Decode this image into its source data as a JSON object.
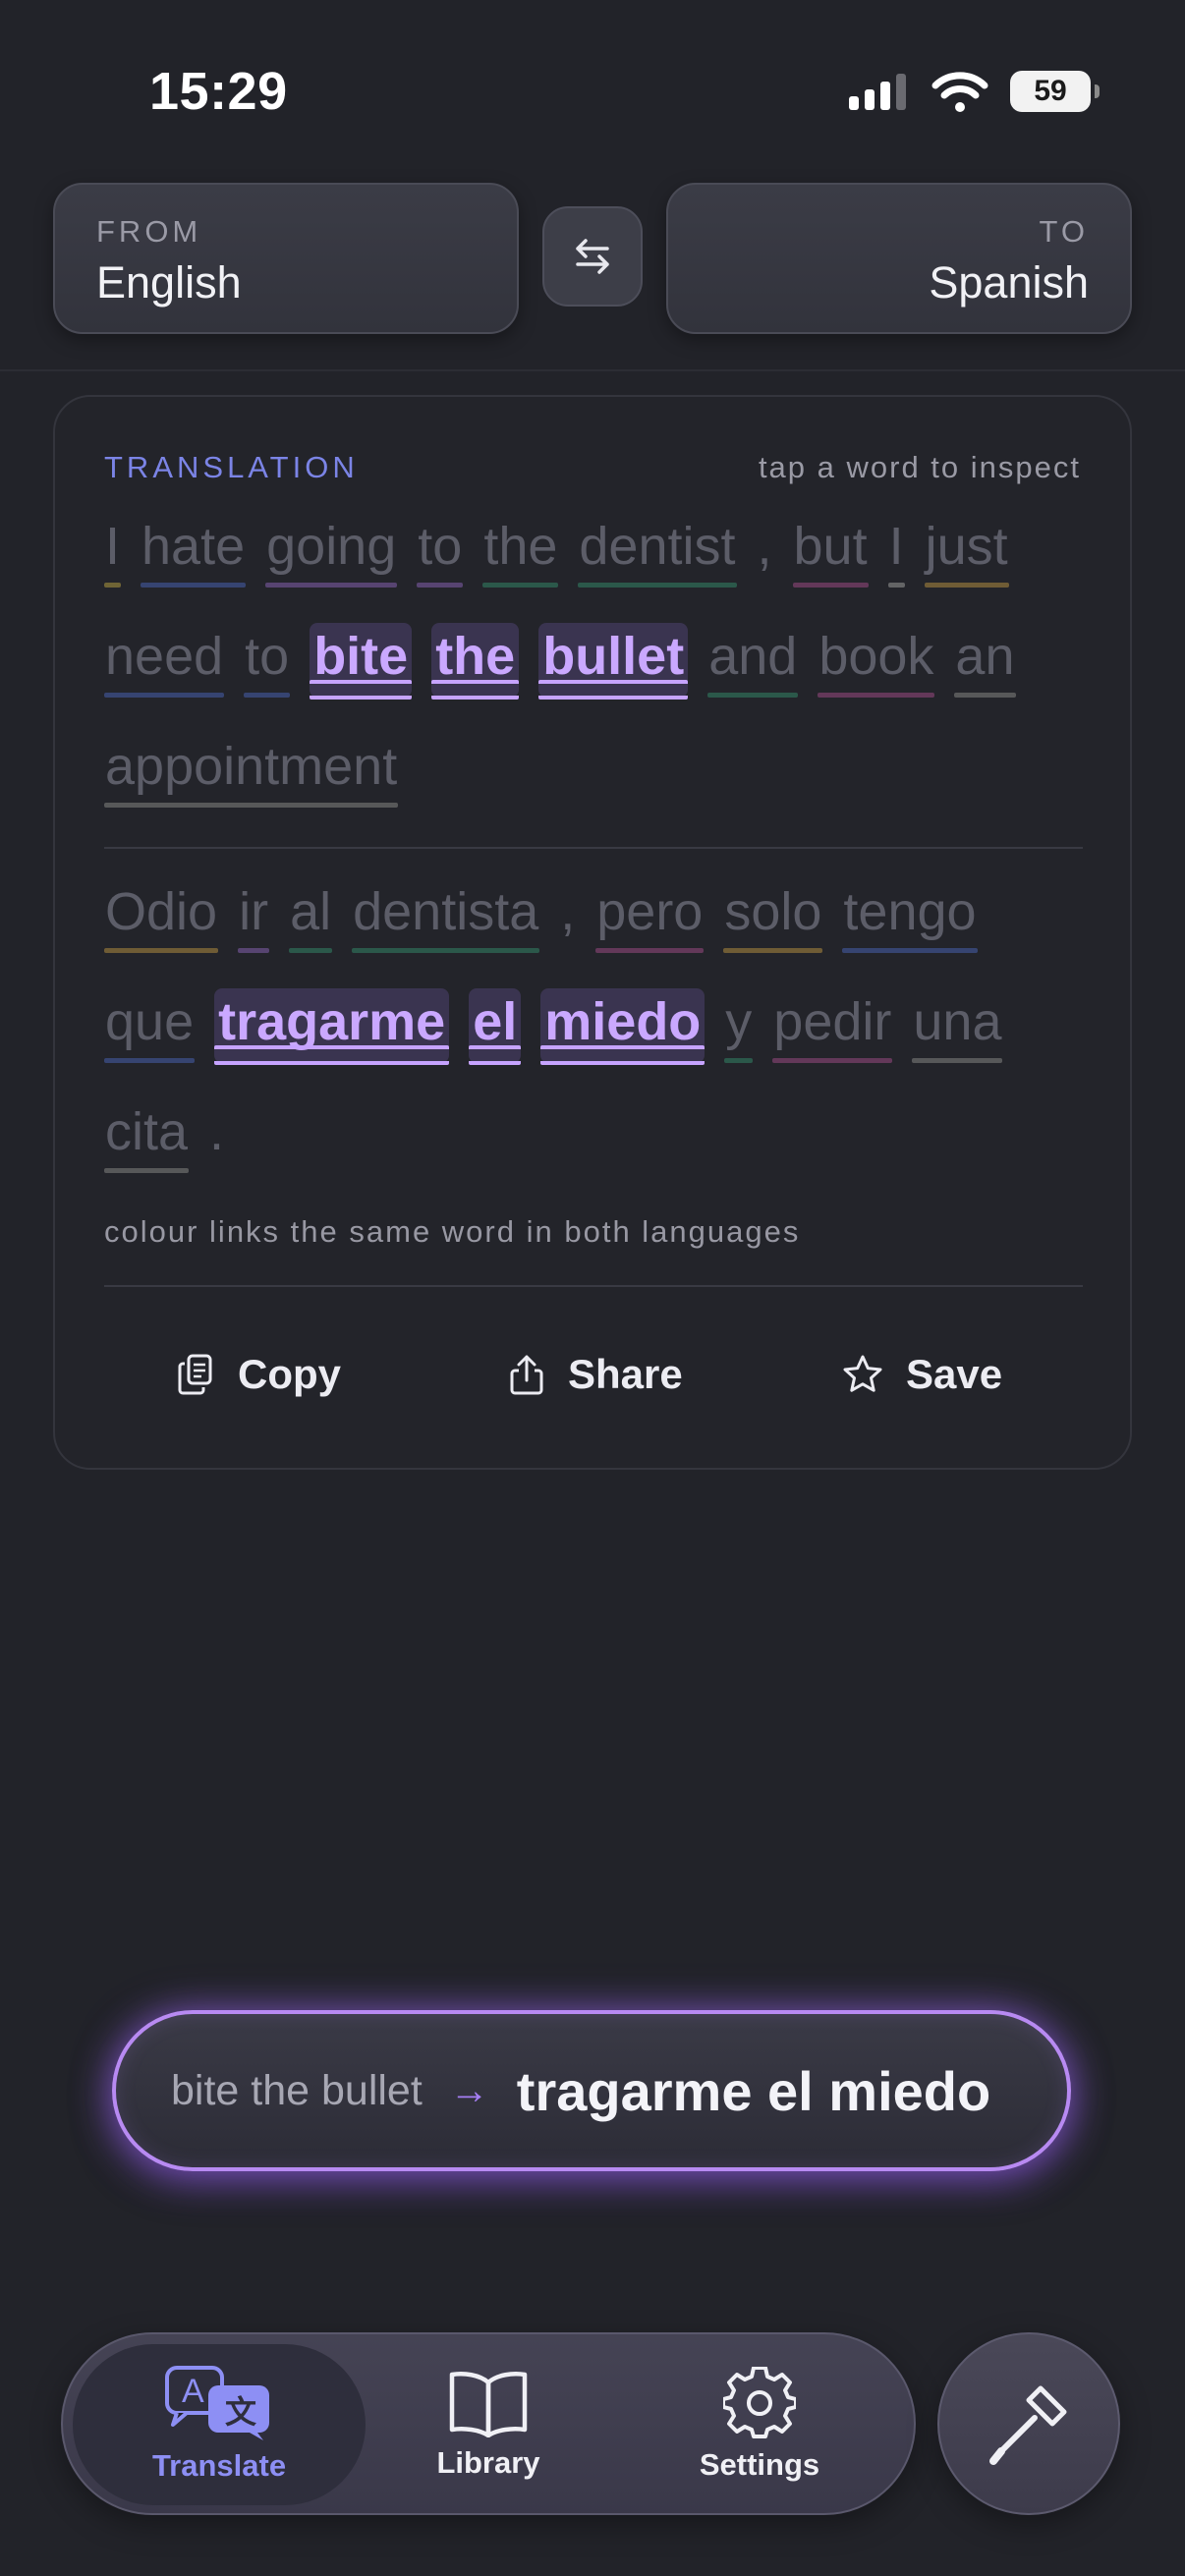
{
  "status": {
    "time": "15:29",
    "battery": "59"
  },
  "languages": {
    "from_caption": "FROM",
    "from_value": "English",
    "to_caption": "TO",
    "to_value": "Spanish"
  },
  "card": {
    "label": "TRANSLATION",
    "hint": "tap a word to inspect",
    "source_tokens": [
      {
        "text": "I",
        "color": "#8a7a3a"
      },
      {
        "text": "hate",
        "color": "#3e4f8a"
      },
      {
        "text": "going",
        "color": "#6a4f8a"
      },
      {
        "text": "to",
        "color": "#6a4f8a"
      },
      {
        "text": "the",
        "color": "#2f6a55"
      },
      {
        "text": "dentist",
        "color": "#2f6a55"
      },
      {
        "text": ",",
        "color": ""
      },
      {
        "text": "but",
        "color": "#7a3f6a"
      },
      {
        "text": "I",
        "color": "#7a7a7a"
      },
      {
        "text": "just",
        "color": "#8a6f3a"
      },
      {
        "text": "need",
        "color": "#3e4f8a"
      },
      {
        "text": "to",
        "color": "#3e4f8a"
      },
      {
        "text": "bite",
        "color": "",
        "hl": true
      },
      {
        "text": "the",
        "color": "",
        "hl": true
      },
      {
        "text": "bullet",
        "color": "",
        "hl": true
      },
      {
        "text": "and",
        "color": "#2f6a55"
      },
      {
        "text": "book",
        "color": "#7a3f6a"
      },
      {
        "text": "an",
        "color": "#6a6a6a"
      },
      {
        "text": "appointment",
        "color": "#6a6a6a"
      }
    ],
    "target_tokens": [
      {
        "text": "Odio",
        "color": "#8a6f3a"
      },
      {
        "text": "ir",
        "color": "#6a4f8a"
      },
      {
        "text": "al",
        "color": "#2f6a55"
      },
      {
        "text": "dentista",
        "color": "#2f6a55"
      },
      {
        "text": ",",
        "color": ""
      },
      {
        "text": "pero",
        "color": "#7a3f6a"
      },
      {
        "text": "solo",
        "color": "#8a6f3a"
      },
      {
        "text": "tengo",
        "color": "#3e4f8a"
      },
      {
        "text": "que",
        "color": "#3e4f8a"
      },
      {
        "text": "tragarme",
        "color": "",
        "hl": true
      },
      {
        "text": "el",
        "color": "",
        "hl": true
      },
      {
        "text": "miedo",
        "color": "",
        "hl": true
      },
      {
        "text": "y",
        "color": "#2f6a55"
      },
      {
        "text": "pedir",
        "color": "#7a3f6a"
      },
      {
        "text": "una",
        "color": "#6a6a6a"
      },
      {
        "text": "cita",
        "color": "#6a6a6a"
      },
      {
        "text": ".",
        "color": ""
      }
    ],
    "legend": "colour links the same word in both languages",
    "actions": {
      "copy": "Copy",
      "share": "Share",
      "save": "Save"
    }
  },
  "phrase": {
    "source": "bite the bullet",
    "arrow": "→",
    "target": "tragarme el miedo"
  },
  "tabs": {
    "translate": "Translate",
    "library": "Library",
    "settings": "Settings"
  },
  "icons": {
    "swap": "swap-arrows-icon",
    "copy": "copy-icon",
    "share": "share-icon",
    "save": "star-icon",
    "translate": "translate-icon",
    "library": "book-icon",
    "settings": "gear-icon",
    "tool": "screwdriver-icon"
  }
}
